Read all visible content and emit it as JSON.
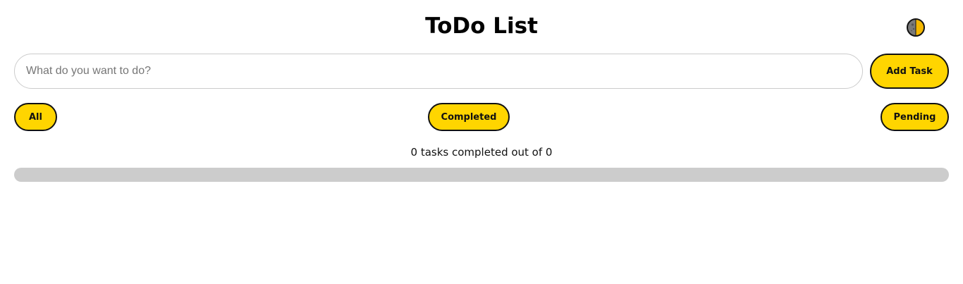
{
  "header": {
    "title": "ToDo List",
    "theme_toggle_icon": "half-moon-icon"
  },
  "form": {
    "input_value": "",
    "input_placeholder": "What do you want to do?",
    "add_label": "Add Task"
  },
  "filters": {
    "all_label": "All",
    "completed_label": "Completed",
    "pending_label": "Pending"
  },
  "progress": {
    "status_text": "0 tasks completed out of 0",
    "completed": 0,
    "total": 0,
    "fraction": 0
  },
  "colors": {
    "accent": "#ffd500",
    "border": "#111111",
    "track": "#cccccc",
    "input_border": "#cccccc"
  },
  "tasks": []
}
